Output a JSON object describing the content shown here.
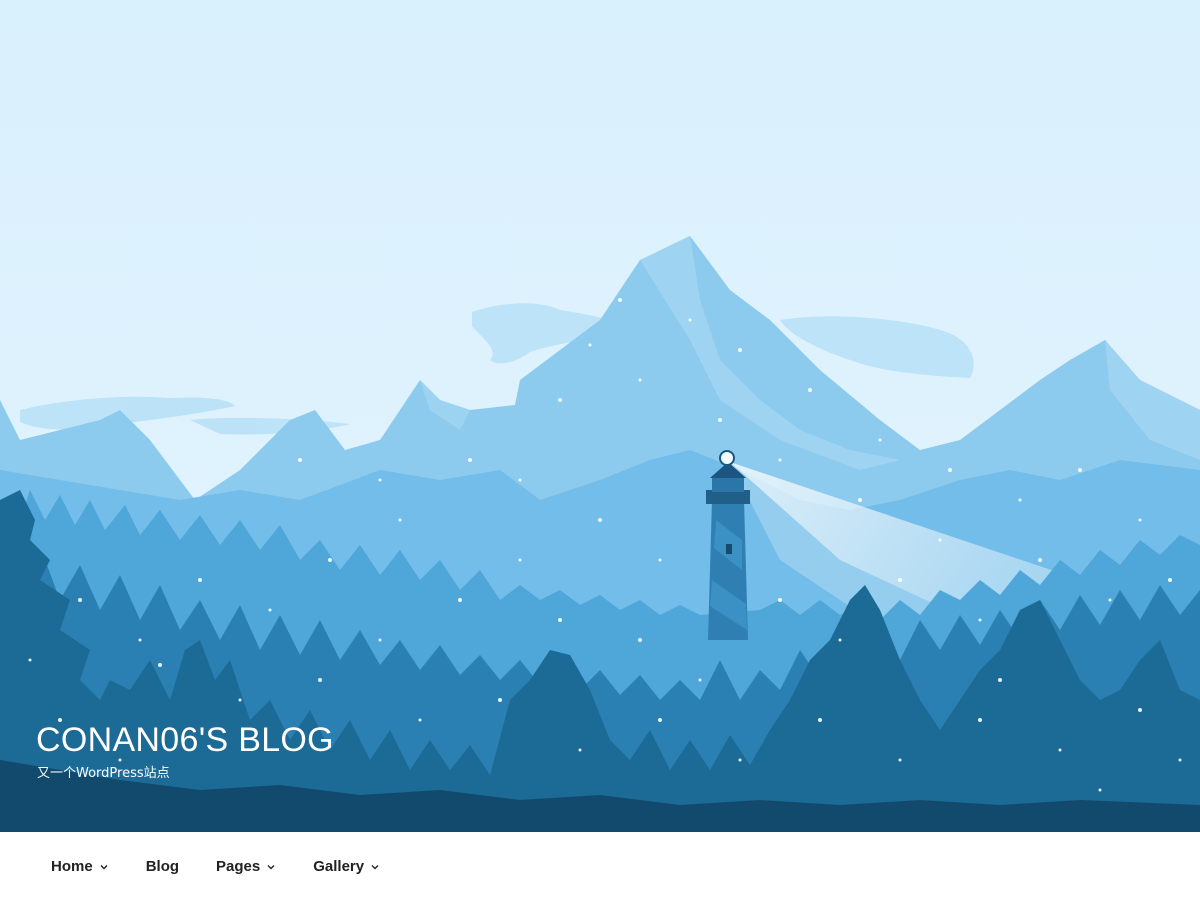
{
  "header": {
    "site_title": "CONAN06'S BLOG",
    "tagline": "又一个WordPress站点",
    "image": "snowy-mountain-lighthouse-illustration"
  },
  "nav": {
    "items": [
      {
        "label": "Home",
        "has_submenu": true
      },
      {
        "label": "Blog",
        "has_submenu": false
      },
      {
        "label": "Pages",
        "has_submenu": true
      },
      {
        "label": "Gallery",
        "has_submenu": true
      }
    ],
    "submenu_icon": "chevron-down-icon"
  },
  "colors": {
    "sky": "#d9f0fd",
    "mountain_far": "#8ccbee",
    "mountain_mid": "#72bde9",
    "forest_mid": "#3f93c6",
    "forest_dark": "#1c6a96",
    "forest_darkest": "#114a6c",
    "nav_text": "#222222",
    "nav_background": "#ffffff"
  }
}
